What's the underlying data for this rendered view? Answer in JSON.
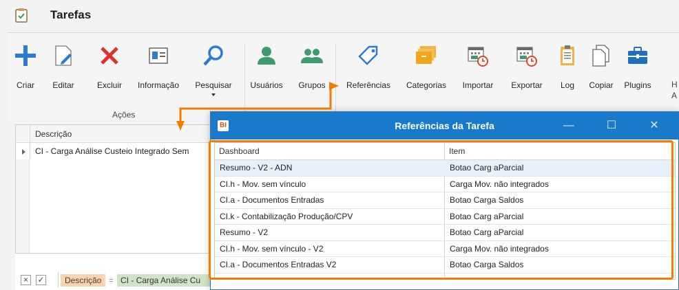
{
  "window": {
    "title": "Tarefas"
  },
  "ribbon": {
    "buttons": [
      {
        "id": "criar",
        "label": "Criar",
        "icon": "plus-icon"
      },
      {
        "id": "editar",
        "label": "Editar",
        "icon": "edit-icon"
      },
      {
        "id": "excluir",
        "label": "Excluir",
        "icon": "delete-icon"
      },
      {
        "id": "informacao",
        "label": "Informação",
        "icon": "info-card-icon"
      },
      {
        "id": "pesquisar",
        "label": "Pesquisar",
        "icon": "search-icon"
      },
      {
        "id": "usuarios",
        "label": "Usuários",
        "icon": "user-icon"
      },
      {
        "id": "grupos",
        "label": "Grupos",
        "icon": "group-icon"
      },
      {
        "id": "referencias",
        "label": "Referências",
        "icon": "tag-icon"
      },
      {
        "id": "categorias",
        "label": "Categorias",
        "icon": "folders-icon"
      },
      {
        "id": "importar",
        "label": "Importar",
        "icon": "calendar-import-icon"
      },
      {
        "id": "exportar",
        "label": "Exportar",
        "icon": "calendar-export-icon"
      },
      {
        "id": "log",
        "label": "Log",
        "icon": "clipboard-icon"
      },
      {
        "id": "copiar",
        "label": "Copiar",
        "icon": "copy-icon"
      },
      {
        "id": "plugins",
        "label": "Plugins",
        "icon": "briefcase-icon"
      }
    ],
    "cut_label_1": "H",
    "cut_label_2": "A",
    "group_acoes": "Ações"
  },
  "grid": {
    "header": "Descrição",
    "row": "CI - Carga Análise Custeio Integrado Sem"
  },
  "filter": {
    "field": "Descrição",
    "operator": "=",
    "value": "CI - Carga Análise Cu"
  },
  "dialog": {
    "logo": "BI",
    "title": "Referências da Tarefa",
    "columns": [
      "Dashboard",
      "Item"
    ],
    "rows": [
      {
        "dashboard": "Resumo - V2 - ADN",
        "item": "Botao Carg aParcial"
      },
      {
        "dashboard": "CI.h - Mov. sem vínculo",
        "item": "Carga Mov. não integrados"
      },
      {
        "dashboard": "CI.a -  Documentos Entradas",
        "item": "Botao Carga Saldos"
      },
      {
        "dashboard": "CI.k - Contabilização Produção/CPV",
        "item": "Botao Carg aParcial"
      },
      {
        "dashboard": " Resumo - V2",
        "item": "Botao Carg aParcial"
      },
      {
        "dashboard": "CI.h - Mov. sem vínculo - V2",
        "item": "Carga Mov. não integrados"
      },
      {
        "dashboard": "CI.a -  Documentos Entradas V2",
        "item": "Botao Carga Saldos"
      }
    ]
  },
  "colors": {
    "accent": "#1979ca",
    "highlight": "#f57c00",
    "selected_row": "#e8f1fb"
  }
}
